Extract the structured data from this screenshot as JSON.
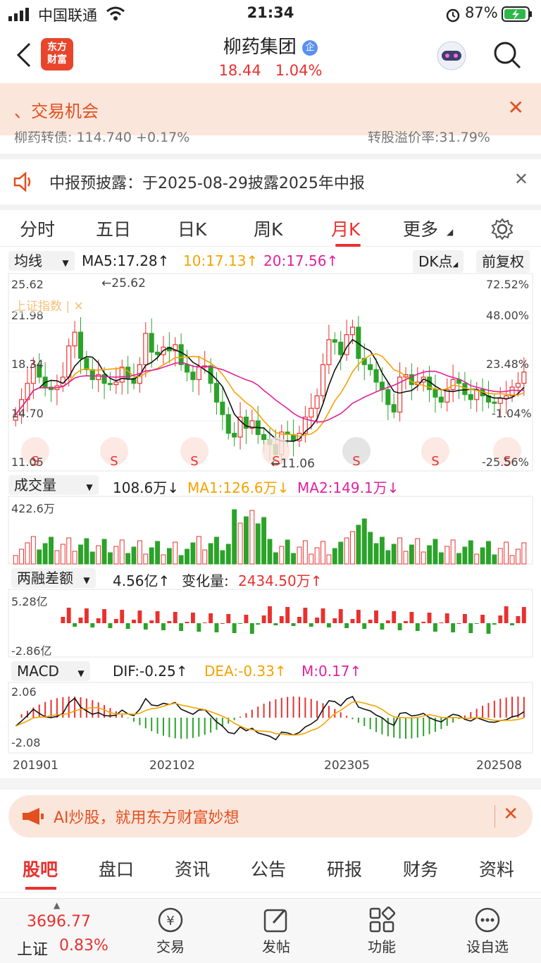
{
  "status_bar": {
    "carrier": "中国联通",
    "time": "21:34",
    "battery": "87%"
  },
  "header": {
    "stock_name": "柳药集团",
    "badge": "企",
    "price": "18.44",
    "change": "1.04%",
    "logo": "东方\n财富"
  },
  "banner": {
    "text": "、交易机会",
    "close": "✕"
  },
  "convertible_row": {
    "left": "柳药转债:  114.740   +0.17%",
    "right": "转股溢价率:31.79%"
  },
  "notice": {
    "text": "中报预披露：于2025-08-29披露2025年中报",
    "close": "✕"
  },
  "tabs": [
    {
      "label": "分时",
      "active": false
    },
    {
      "label": "五日",
      "active": false
    },
    {
      "label": "日K",
      "active": false
    },
    {
      "label": "周K",
      "active": false
    },
    {
      "label": "月K",
      "active": true
    },
    {
      "label": "更多",
      "active": false
    }
  ],
  "ma_panel": {
    "selector": "均线",
    "ma5": "MA5:17.28↑",
    "ma10": "10:17.13↑",
    "ma20": "20:17.56↑",
    "dk_button": "DK点",
    "fq_button": "前复权",
    "y_left": [
      "25.62",
      "21.98",
      "18.34",
      "14.70",
      "11.05"
    ],
    "y_right": [
      "72.52%",
      "48.00%",
      "23.48%",
      "-1.04%",
      "-25.56%"
    ],
    "high_label": "25.62",
    "low_label": "11.06",
    "overlay_label": "上证指数 | ✕"
  },
  "volume_panel": {
    "selector": "成交量",
    "value": "108.6万↓",
    "ma1": "MA1:126.6万↓",
    "ma2": "MA2:149.1万↓",
    "axis_top": "422.6万"
  },
  "margin_panel": {
    "selector": "两融差额",
    "value": "4.56亿↑",
    "change_label": "变化量:",
    "change_value": "2434.50万↑",
    "axis_top": "5.28亿",
    "axis_bottom": "-2.86亿"
  },
  "macd_panel": {
    "selector": "MACD",
    "dif": "DIF:-0.25↑",
    "dea": "DEA:-0.33↑",
    "m": "M:0.17↑",
    "axis_top": "2.06",
    "axis_bottom": "-2.08"
  },
  "x_axis": [
    "201901",
    "202102",
    "202305",
    "202508"
  ],
  "ai_banner": {
    "text": "AI炒股，就用东方财富妙想",
    "close": "✕"
  },
  "bottom_tabs": [
    {
      "label": "股吧",
      "active": true
    },
    {
      "label": "盘口",
      "active": false
    },
    {
      "label": "资讯",
      "active": false
    },
    {
      "label": "公告",
      "active": false
    },
    {
      "label": "研报",
      "active": false
    },
    {
      "label": "财务",
      "active": false
    },
    {
      "label": "资料",
      "active": false
    }
  ],
  "bottom_bar": {
    "index_value": "3696.77",
    "index_name": "上证",
    "index_change": "0.83%",
    "items": [
      "交易",
      "发帖",
      "功能",
      "设自选"
    ]
  },
  "colors": {
    "up": "#e8312f",
    "down": "#2aa329",
    "ma10": "#f4a300",
    "ma20": "#e0229c",
    "accent": "#e2501f"
  },
  "chart_data": {
    "type": "candlestick",
    "title": "",
    "xlabel": "",
    "ylabel": "",
    "x_ticks": [
      "201901",
      "202102",
      "202305",
      "202508"
    ],
    "ylim": [
      11.05,
      25.62
    ],
    "high": 25.62,
    "low": 11.06,
    "closes": [
      15.0,
      16.2,
      17.5,
      19.0,
      18.0,
      17.2,
      17.0,
      17.3,
      18.0,
      20.5,
      21.6,
      19.5,
      18.6,
      17.8,
      18.2,
      17.5,
      17.4,
      17.6,
      18.8,
      17.9,
      17.5,
      19.0,
      21.5,
      20.0,
      19.8,
      20.4,
      20.1,
      20.6,
      19.0,
      18.4,
      17.8,
      18.8,
      18.9,
      17.5,
      16.0,
      15.0,
      13.5,
      13.2,
      14.8,
      13.9,
      14.5,
      13.4,
      13.0,
      12.6,
      11.8,
      13.6,
      13.4,
      12.9,
      13.5,
      14.8,
      15.5,
      16.5,
      19.0,
      21.0,
      20.8,
      19.8,
      21.4,
      22.0,
      19.5,
      19.0,
      18.6,
      17.6,
      17.0,
      15.8,
      15.2,
      18.0,
      18.2,
      17.4,
      17.6,
      18.0,
      17.0,
      16.4,
      16.0,
      17.0,
      17.8,
      17.5,
      16.6,
      16.2,
      17.0,
      16.5,
      16.0,
      15.9,
      16.3,
      16.5,
      17.2,
      17.5,
      18.4
    ]
  }
}
